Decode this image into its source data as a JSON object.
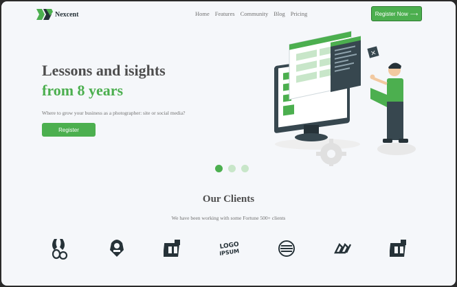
{
  "brand": {
    "name": "Nexcent",
    "accent": "#4caf4f",
    "text_dark": "#4d4d4d",
    "text_gray": "#717171"
  },
  "nav": {
    "items": [
      "Home",
      "Features",
      "Community",
      "Blog",
      "Pricing"
    ]
  },
  "header_cta": {
    "label": "Register Now",
    "icon": "arrow-right-icon"
  },
  "hero": {
    "title_line1": "Lessons and isights",
    "title_line2": "from 8 years",
    "subtitle": "Where to grow your business as a photographer: site or social media?",
    "button_label": "Register"
  },
  "carousel": {
    "count": 3,
    "active": 1
  },
  "clients": {
    "title": "Our Clients",
    "subtitle": "We have been working with some Fortune 500+ clients",
    "logos": [
      "client-logo-1",
      "client-logo-2",
      "client-logo-3",
      "client-logo-4",
      "client-logo-5",
      "client-logo-6",
      "client-logo-7"
    ],
    "logo4_text": "LOGO IPSUM"
  }
}
